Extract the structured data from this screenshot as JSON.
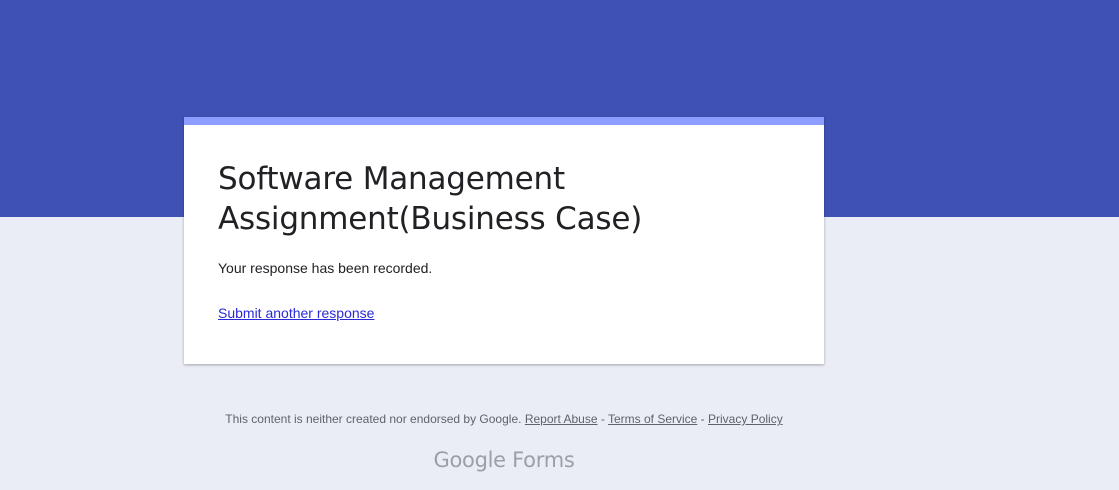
{
  "colors": {
    "header_band": "#3f51b5",
    "card_accent": "#8c9eff",
    "page_background": "#ebedf6",
    "card_background": "#ffffff",
    "link": "#2a2ad6"
  },
  "form": {
    "title": "Software Management Assignment(Business Case)",
    "confirmation_message": "Your response has been recorded.",
    "submit_another_label": "Submit another response"
  },
  "footer": {
    "disclaimer": "This content is neither created nor endorsed by Google.",
    "separator": " - ",
    "report_abuse_label": "Report Abuse",
    "terms_label": "Terms of Service",
    "privacy_label": "Privacy Policy"
  },
  "brand": {
    "google": "Google",
    "product": "Forms"
  }
}
